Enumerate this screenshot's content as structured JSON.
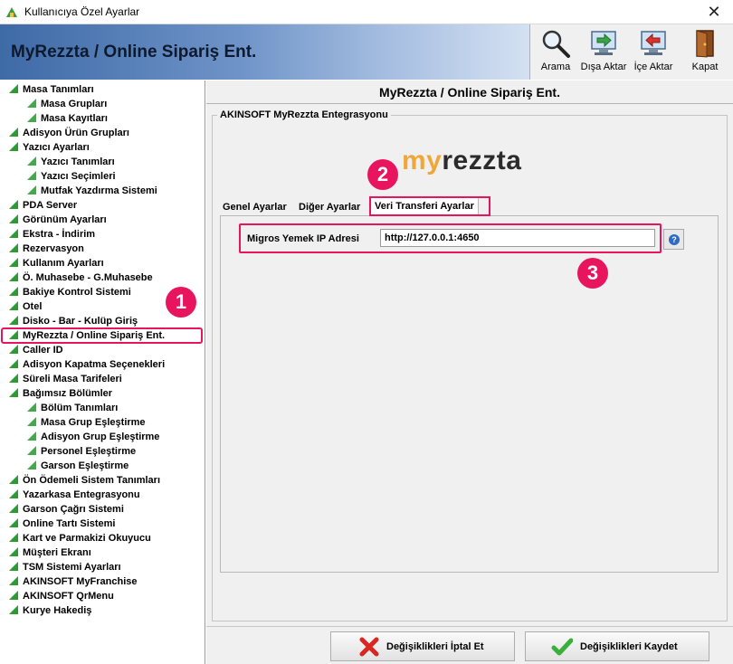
{
  "window": {
    "title": "Kullanıcıya Özel Ayarlar",
    "close_glyph": "✕"
  },
  "header": {
    "banner_title": "MyRezzta / Online Sipariş Ent.",
    "tools": [
      {
        "label": "Arama",
        "icon": "search-icon"
      },
      {
        "label": "Dışa Aktar",
        "icon": "export-icon"
      },
      {
        "label": "İçe Aktar",
        "icon": "import-icon"
      },
      {
        "label": "Kapat",
        "icon": "exit-door-icon"
      }
    ]
  },
  "tree": {
    "items": [
      "Masa Tanımları",
      "Masa Grupları",
      "Masa Kayıtları",
      "Adisyon Ürün Grupları",
      "Yazıcı Ayarları",
      "Yazıcı Tanımları",
      "Yazıcı Seçimleri",
      "Mutfak Yazdırma Sistemi",
      "PDA Server",
      "Görünüm Ayarları",
      "Ekstra - İndirim",
      "Rezervasyon",
      "Kullanım Ayarları",
      "Ö. Muhasebe - G.Muhasebe",
      "Bakiye Kontrol Sistemi",
      "Otel",
      "Disko - Bar - Kulüp Giriş",
      "MyRezzta / Online Sipariş Ent.",
      "Caller ID",
      "Adisyon Kapatma Seçenekleri",
      "Süreli Masa Tarifeleri",
      "Bağımsız Bölümler",
      "Bölüm Tanımları",
      "Masa Grup Eşleştirme",
      "Adisyon Grup Eşleştirme",
      "Personel Eşleştirme",
      "Garson Eşleştirme",
      "Ön Ödemeli Sistem Tanımları",
      "Yazarkasa Entegrasyonu",
      "Garson Çağrı Sistemi",
      "Online Tartı Sistemi",
      "Kart ve Parmakizi Okuyucu",
      "Müşteri Ekranı",
      "TSM Sistemi Ayarları",
      "AKINSOFT MyFranchise",
      "AKINSOFT QrMenu",
      "Kurye Hakediş"
    ],
    "selected": "MyRezzta / Online Sipariş Ent."
  },
  "main": {
    "title": "MyRezzta / Online Sipariş Ent.",
    "group_label": "AKINSOFT MyRezzta Entegrasyonu",
    "logo": {
      "part1": "my",
      "part2": "rezzta"
    },
    "tabs": [
      {
        "label": "Genel Ayarlar"
      },
      {
        "label": "Diğer Ayarlar"
      },
      {
        "label": "Veri Transferi Ayarlar"
      }
    ],
    "active_tab": "Veri Transferi Ayarlar",
    "ip_label": "Migros Yemek IP Adresi",
    "ip_value": "http://127.0.0.1:4650",
    "help_glyph": "?"
  },
  "callouts": [
    "1",
    "2",
    "3"
  ],
  "bottom": {
    "cancel_label": "Değişiklikleri İptal Et",
    "save_label": "Değişiklikleri Kaydet"
  },
  "colors": {
    "highlight": "#e8155e",
    "tree_icon": "#2e9a35",
    "logo_accent": "#f0a73a"
  }
}
